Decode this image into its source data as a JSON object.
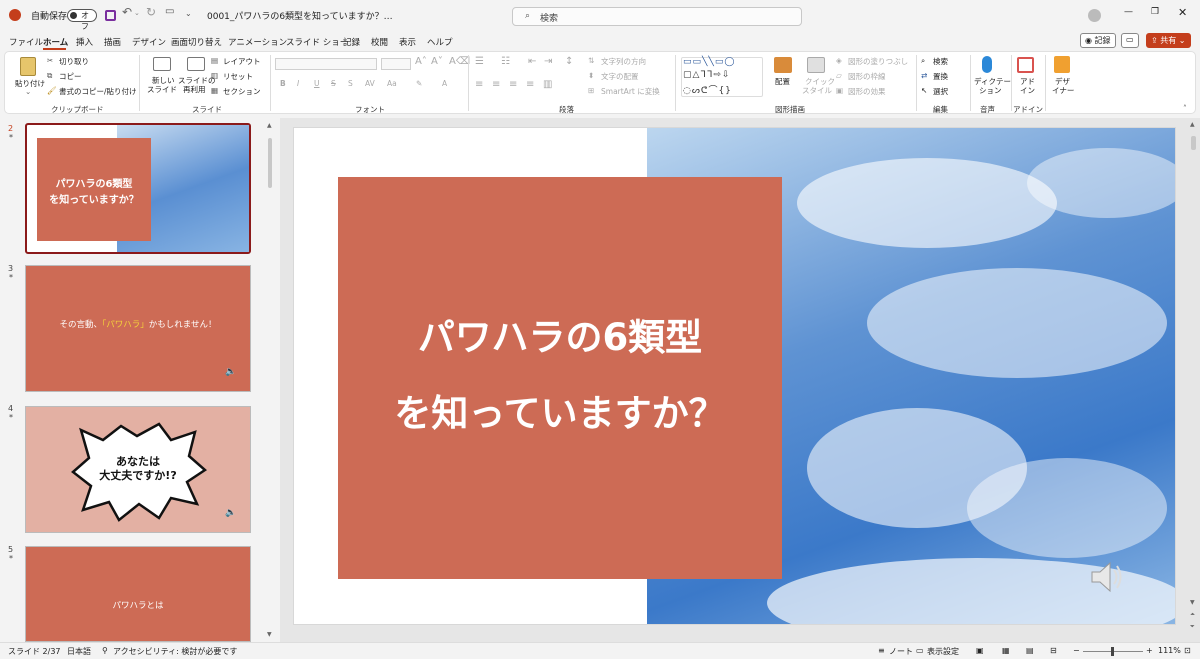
{
  "titlebar": {
    "autosave_label": "自動保存",
    "autosave_state": "オフ",
    "doc_title": "0001_パワハラの6類型を知っていますか？…",
    "search_placeholder": "検索"
  },
  "menu": [
    "ファイル",
    "ホーム",
    "挿入",
    "描画",
    "デザイン",
    "画面切り替え",
    "アニメーション",
    "スライド ショー",
    "記録",
    "校閲",
    "表示",
    "ヘルプ"
  ],
  "menu_active": "ホーム",
  "top_right": {
    "record": "記録",
    "share": "共有"
  },
  "ribbon": {
    "clipboard": {
      "paste": "貼り付け",
      "cut": "切り取り",
      "copy": "コピー",
      "format_painter": "書式のコピー/貼り付け",
      "group": "クリップボード"
    },
    "slides": {
      "new_slide_1": "新しい",
      "new_slide_2": "スライド",
      "reuse_1": "スライドの",
      "reuse_2": "再利用",
      "layout": "レイアウト",
      "reset": "リセット",
      "section": "セクション",
      "group": "スライド"
    },
    "font": {
      "bold": "B",
      "italic": "I",
      "underline": "U",
      "strike": "S",
      "aa": "Aa",
      "group": "フォント"
    },
    "paragraph": {
      "text_direction": "文字列の方向",
      "align_text": "文字の配置",
      "smartart": "SmartArt に変換",
      "group": "段落"
    },
    "drawing": {
      "arrange": "配置",
      "quick_styles_1": "クイック",
      "quick_styles_2": "スタイル",
      "fill": "図形の塗りつぶし",
      "outline": "図形の枠線",
      "effects": "図形の効果",
      "group": "図形描画"
    },
    "editing": {
      "find": "検索",
      "replace": "置換",
      "select": "選択",
      "group": "編集"
    },
    "voice": {
      "dictate_1": "ディクテー",
      "dictate_2": "ション",
      "group": "音声"
    },
    "addins": {
      "addin_1": "アド",
      "addin_2": "イン",
      "group": "アドイン"
    },
    "designer": {
      "label_1": "デザ",
      "label_2": "イナー"
    }
  },
  "thumbnails": [
    {
      "num": "2",
      "lines": [
        "パワハラの6類型",
        "を知っていますか？"
      ]
    },
    {
      "num": "3",
      "text_pre": "その言動、",
      "text_hl": "「パワハラ」",
      "text_post": "かもしれません！"
    },
    {
      "num": "4",
      "lines": [
        "あなたは",
        "大丈夫ですか!?"
      ]
    },
    {
      "num": "5",
      "text": "パワハラとは"
    }
  ],
  "slide": {
    "line1": "パワハラの6類型",
    "line2": "を知っていますか？"
  },
  "status": {
    "slide_info": "スライド 2/37",
    "language": "日本語",
    "accessibility": "アクセシビリティ: 検討が必要です",
    "notes": "ノート",
    "display_settings": "表示設定",
    "zoom": "111%"
  },
  "colors": {
    "accent": "#c43e1c",
    "slide_red": "#cd6b55",
    "thumb4_bg": "#e3b0a3"
  }
}
